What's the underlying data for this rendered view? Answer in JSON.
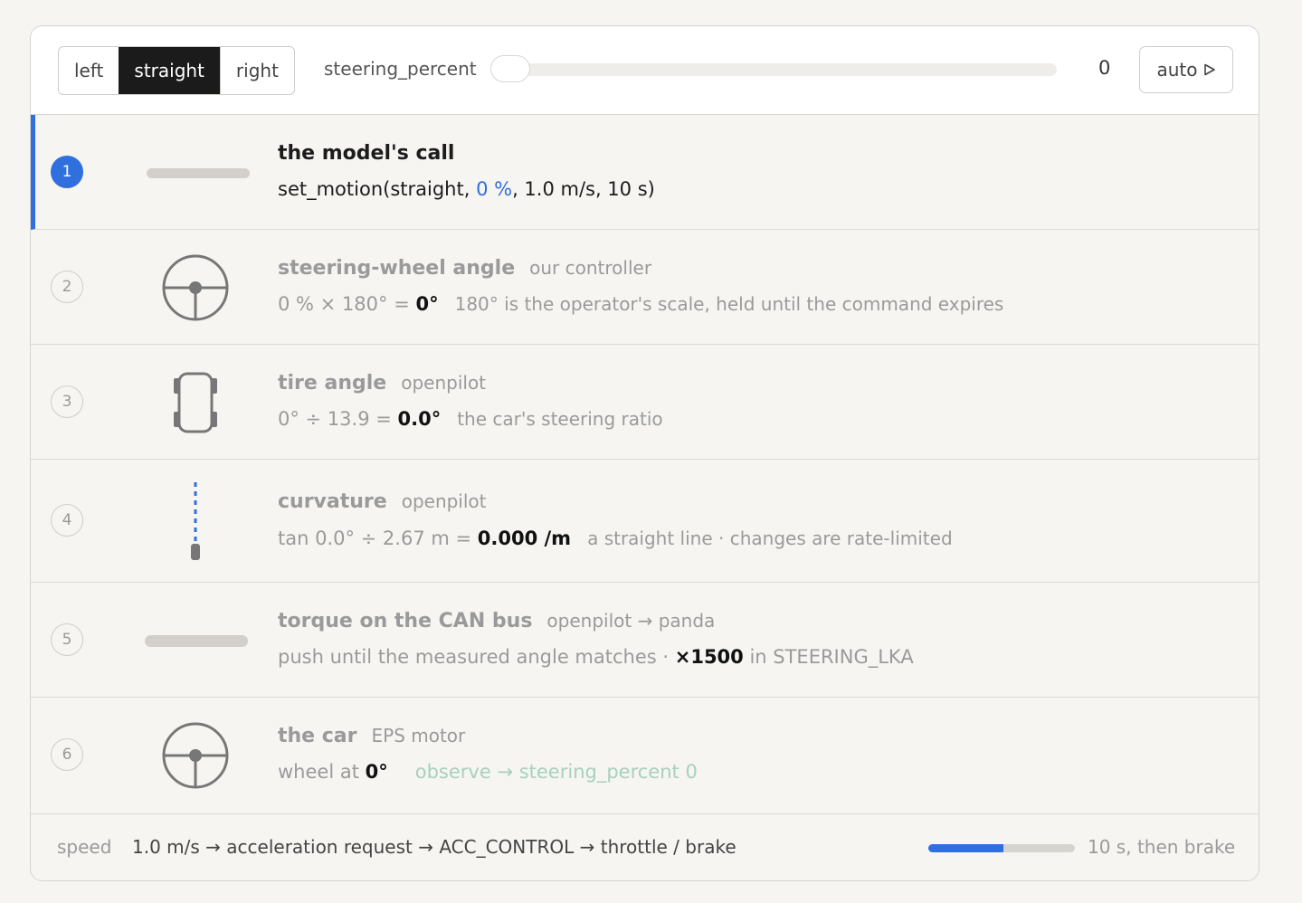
{
  "toolbar": {
    "direction_options": [
      "left",
      "straight",
      "right"
    ],
    "selected_direction": "straight",
    "slider_label": "steering_percent",
    "slider_value": "0",
    "slider_fraction": 0,
    "auto_label": "auto"
  },
  "steps": [
    {
      "num": "1",
      "active": true,
      "glyph": "bar-icon",
      "title": "the model's call",
      "sub": "",
      "line": {
        "pre": "set_motion(straight, ",
        "highlight": "0 %",
        "post": ", 1.0 m/s, 10 s)"
      }
    },
    {
      "num": "2",
      "glyph": "steering-wheel-icon",
      "title": "steering-wheel angle",
      "sub": "our controller",
      "line": {
        "pre": "0 % × 180° = ",
        "bold": "0°",
        "note": "180° is the operator's scale, held until the command expires"
      }
    },
    {
      "num": "3",
      "glyph": "car-topview-icon",
      "title": "tire angle",
      "sub": "openpilot",
      "line": {
        "pre": "0° ÷ 13.9 = ",
        "bold": "0.0°",
        "note": "the car's steering ratio"
      }
    },
    {
      "num": "4",
      "glyph": "path-line-icon",
      "title": "curvature",
      "sub": "openpilot",
      "line": {
        "pre": "tan 0.0° ÷ 2.67 m = ",
        "bold": "0.000 /m",
        "note": "a straight line · changes are rate-limited"
      }
    },
    {
      "num": "5",
      "glyph": "bar-icon",
      "title": "torque on the CAN bus",
      "sub": "openpilot → panda",
      "line": {
        "pre": "push until the measured angle matches · ",
        "bold": "×1500",
        "post": " in STEERING_LKA"
      }
    },
    {
      "num": "6",
      "glyph": "steering-wheel-icon",
      "title": "the car",
      "sub": "EPS motor",
      "line": {
        "pre": "wheel at ",
        "bold": "0°",
        "link": "observe → steering_percent 0"
      }
    }
  ],
  "footer": {
    "label": "speed",
    "text": "1.0 m/s → acceleration request → ACC_CONTROL → throttle / brake",
    "progress_fraction": 0.51,
    "right_text": "10 s, then brake"
  },
  "colors": {
    "accent": "#2f6fde",
    "dark": "#1b1b1b",
    "muted": "#9a9a9a",
    "link": "#a8d0bd"
  }
}
